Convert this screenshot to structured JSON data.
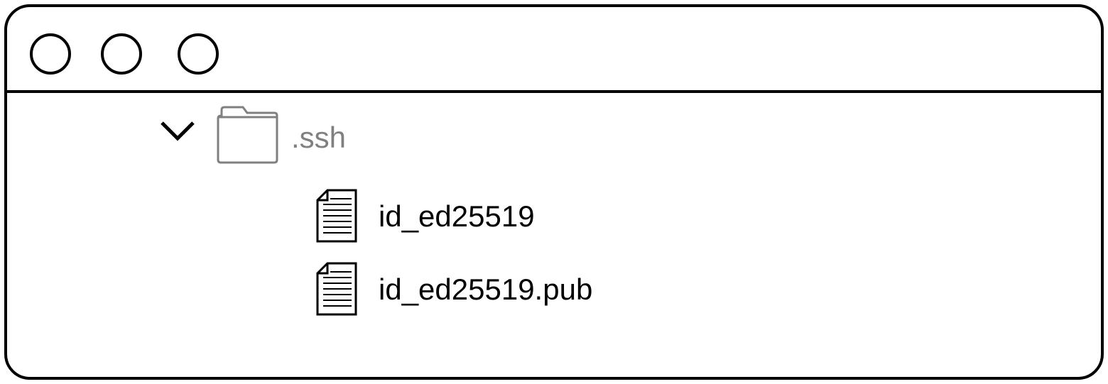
{
  "window": {
    "buttons": [
      {
        "name": "close"
      },
      {
        "name": "minimize"
      },
      {
        "name": "maximize"
      }
    ]
  },
  "tree": {
    "folder": {
      "label": ".ssh",
      "expanded": true,
      "icon": "folder-icon",
      "chevron_icon": "chevron-down-icon"
    },
    "files": [
      {
        "label": "id_ed25519",
        "icon": "document-icon"
      },
      {
        "label": "id_ed25519.pub",
        "icon": "document-icon"
      }
    ]
  },
  "colors": {
    "border": "#000000",
    "folder_label": "#808080",
    "file_label": "#000000",
    "folder_icon_stroke": "#808080"
  }
}
